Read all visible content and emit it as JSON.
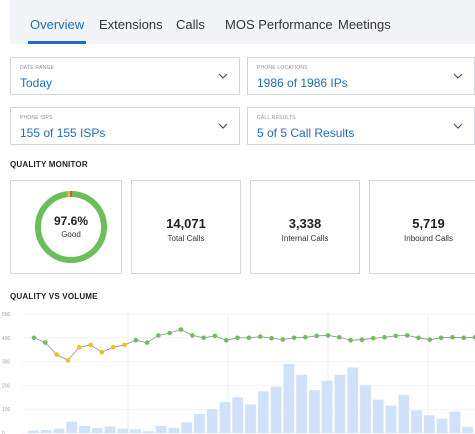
{
  "tabs": [
    {
      "label": "Overview",
      "active": true
    },
    {
      "label": "Extensions",
      "active": false
    },
    {
      "label": "Calls",
      "active": false
    },
    {
      "label": "MOS Performance",
      "active": false
    },
    {
      "label": "Meetings",
      "active": false
    }
  ],
  "filters": {
    "date_range": {
      "label": "DATE RANGE",
      "value": "Today"
    },
    "phone_locations": {
      "label": "PHONE LOCATIONS",
      "value": "1986 of 1986 IPs"
    },
    "phone_isps": {
      "label": "PHONE ISPS",
      "value": "155 of 155 ISPs"
    },
    "call_results": {
      "label": "CALL RESULTS",
      "value": "5 of 5 Call Results"
    }
  },
  "quality_monitor": {
    "title": "QUALITY MONITOR",
    "donut": {
      "percent": "97.6%",
      "label": "Good",
      "good_fraction": 0.976,
      "colors": {
        "good": "#6bbf59",
        "warn": "#f2c014",
        "bad": "#e8453c"
      }
    },
    "cards": [
      {
        "value": "14,071",
        "label": "Total Calls"
      },
      {
        "value": "3,338",
        "label": "Internal Calls"
      },
      {
        "value": "5,719",
        "label": "Inbound Calls"
      }
    ]
  },
  "quality_vs_volume": {
    "title": "QUALITY VS VOLUME"
  },
  "chart_data": {
    "type": "bar",
    "y_ticks": [
      "500",
      "400",
      "300",
      "200",
      "100",
      "0"
    ],
    "ylim": [
      0,
      500
    ],
    "bars": [
      10,
      12,
      18,
      48,
      30,
      20,
      28,
      18,
      15,
      8,
      30,
      22,
      45,
      80,
      100,
      130,
      150,
      120,
      175,
      195,
      290,
      245,
      180,
      220,
      245,
      275,
      200,
      140,
      115,
      160,
      95,
      75,
      60,
      90,
      25
    ],
    "line": {
      "values": [
        400,
        380,
        330,
        305,
        360,
        370,
        340,
        360,
        370,
        390,
        380,
        410,
        420,
        435,
        410,
        400,
        408,
        390,
        400,
        400,
        405,
        398,
        393,
        400,
        402,
        408,
        410,
        402,
        390,
        392,
        398,
        402,
        408,
        410,
        400,
        392,
        400,
        402,
        400,
        402
      ],
      "colors": {
        "good": "#6bbf59",
        "warn": "#f2c014",
        "line": "#8a8f96"
      }
    },
    "colors": {
      "bar": "#cfe2f9"
    }
  }
}
